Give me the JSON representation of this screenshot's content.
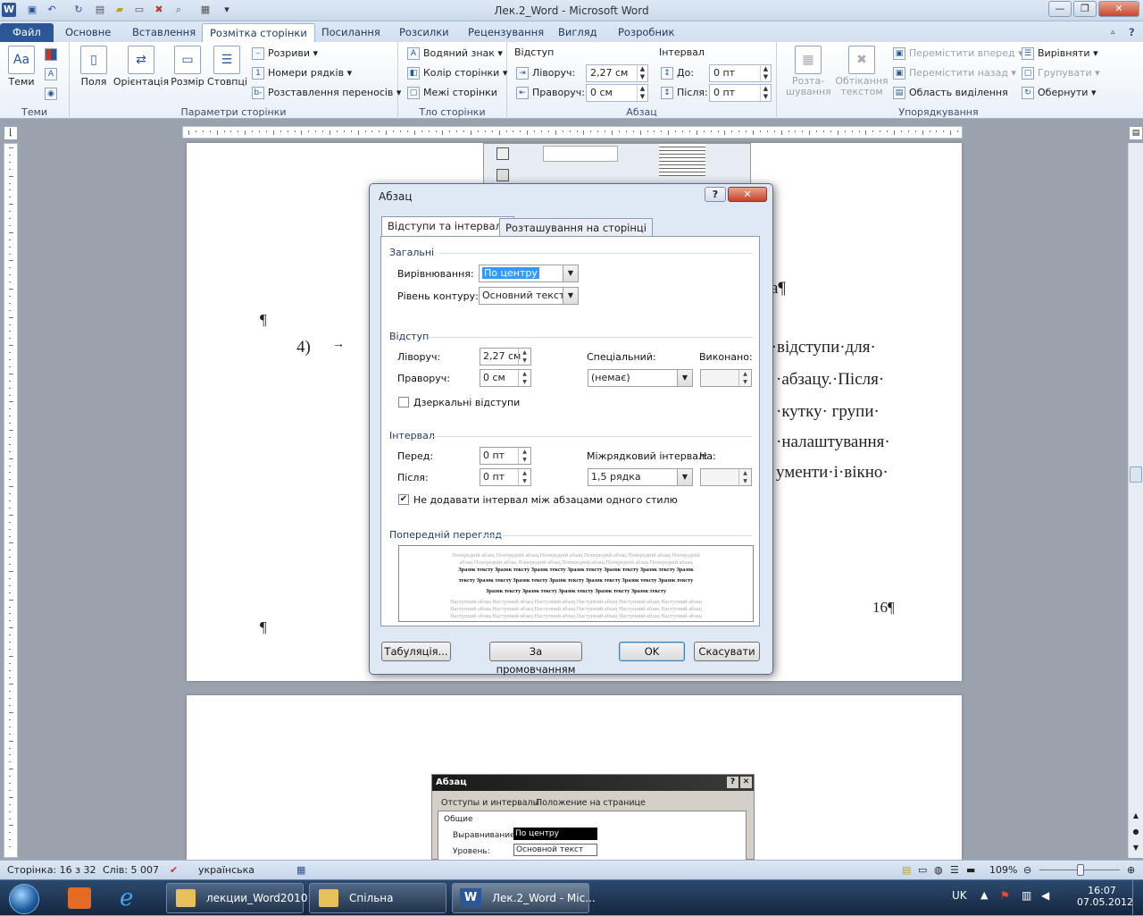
{
  "window": {
    "title": "Лек.2_Word  -  Microsoft Word"
  },
  "tabs": [
    {
      "label": "Файл"
    },
    {
      "label": "Основне"
    },
    {
      "label": "Вставлення"
    },
    {
      "label": "Розмітка сторінки"
    },
    {
      "label": "Посилання"
    },
    {
      "label": "Розсилки"
    },
    {
      "label": "Рецензування"
    },
    {
      "label": "Вигляд"
    },
    {
      "label": "Розробник"
    }
  ],
  "ribbon": {
    "themes": {
      "button": "Теми",
      "group": "Теми"
    },
    "page_setup": {
      "fields": "Поля",
      "orientation": "Орієнтація",
      "size": "Розмір",
      "columns": "Стовпці",
      "breaks": "Розриви",
      "line_numbers": "Номери рядків",
      "hyphenation": "Розставлення переносів",
      "group": "Параметри сторінки"
    },
    "background": {
      "watermark": "Водяний знак",
      "page_color": "Колір сторінки",
      "page_borders": "Межі сторінки",
      "group": "Тло сторінки"
    },
    "paragraph": {
      "indent_title": "Відступ",
      "left_label": "Ліворуч:",
      "left_value": "2,27 см",
      "right_label": "Праворуч:",
      "right_value": "0 см",
      "spacing_title": "Інтервал",
      "before_label": "До:",
      "before_value": "0 пт",
      "after_label": "Після:",
      "after_value": "0 пт",
      "group": "Абзац"
    },
    "arrange": {
      "position": "Розта-шування",
      "wrap": "Обтікання текстом",
      "forward": "Перемістити вперед",
      "backward": "Перемістити назад",
      "selection": "Область виділення",
      "align": "Вирівняти",
      "group_btn": "Групувати",
      "rotate": "Обернути",
      "group": "Упорядкування"
    }
  },
  "document": {
    "pilcrow1": "¶",
    "item_num": "4)",
    "tab_arrow": "→",
    "line1": "ь·відступи·для·",
    "line2": "·абзацу.·Після·",
    "line3": "·кутку·  групи·",
    "line4": "·налаштування·",
    "line5": "ументи·і·вікно·",
    "line_top": "а¶",
    "page_num": "16¶",
    "pilcrow2": "¶"
  },
  "dialog": {
    "title": "Абзац",
    "help": "?",
    "close": "✕",
    "tab1": "Відступи та інтервали",
    "tab2": "Розташування на сторінці",
    "general": "Загальні",
    "alignment_label": "Вирівнювання:",
    "alignment_value": "По центру",
    "outline_label": "Рівень контуру:",
    "outline_value": "Основний текст",
    "indent": "Відступ",
    "left_label": "Ліворуч:",
    "left_value": "2,27 см",
    "right_label": "Праворуч:",
    "right_value": "0 см",
    "special_label": "Спеціальний:",
    "special_value": "(немає)",
    "by_label": "Виконано:",
    "mirror_label": "Дзеркальні відступи",
    "spacing": "Інтервал",
    "before_label": "Перед:",
    "before_value": "0 пт",
    "after_label": "Після:",
    "after_value": "0 пт",
    "line_label": "Міжрядковий інтервал:",
    "line_value": "1,5 рядка",
    "at_label": "На:",
    "dont_add_label": "Не додавати інтервал між абзацами одного стилю",
    "preview": "Попередній перегляд",
    "preview_prev": "Попередній абзац Попередній абзац Попередній абзац Попередній абзац Попередній абзац Попередній",
    "preview_prev2": "абзац Попередній абзац Попередній абзац Попередній абзац Попередній абзац Попередній абзац",
    "preview_sample": "Зразок тексту Зразок тексту Зразок тексту Зразок тексту Зразок тексту Зразок тексту Зразок",
    "preview_sample2": "тексту Зразок тексту Зразок тексту Зразок тексту Зразок тексту Зразок тексту Зразок тексту",
    "preview_sample3": "Зразок тексту Зразок тексту Зразок тексту Зразок тексту Зразок тексту",
    "preview_next": "Наступний абзац Наступний абзац Наступний абзац Наступний абзац Наступний абзац Наступний абзац",
    "tabs_btn": "Табуляція...",
    "default_btn": "За промовчанням",
    "ok": "OK",
    "cancel": "Скасувати"
  },
  "embedded": {
    "title": "Абзац",
    "tab1": "Отступы и интервалы",
    "tab2": "Положение на странице",
    "general": "Общие",
    "align_label": "Выравнивание:",
    "align_value": "По центру",
    "level_label": "Уровень:",
    "level_value": "Основной текст"
  },
  "status": {
    "page": "Сторінка: 16 з 32",
    "words": "Слів: 5 007",
    "lang": "українська",
    "zoom": "109%"
  },
  "taskbar": {
    "item1": "лекции_Word2010",
    "item2": "Спільна",
    "item3": "Лек.2_Word - Mic...",
    "lang": "UK",
    "time": "16:07",
    "date": "07.05.2012"
  }
}
